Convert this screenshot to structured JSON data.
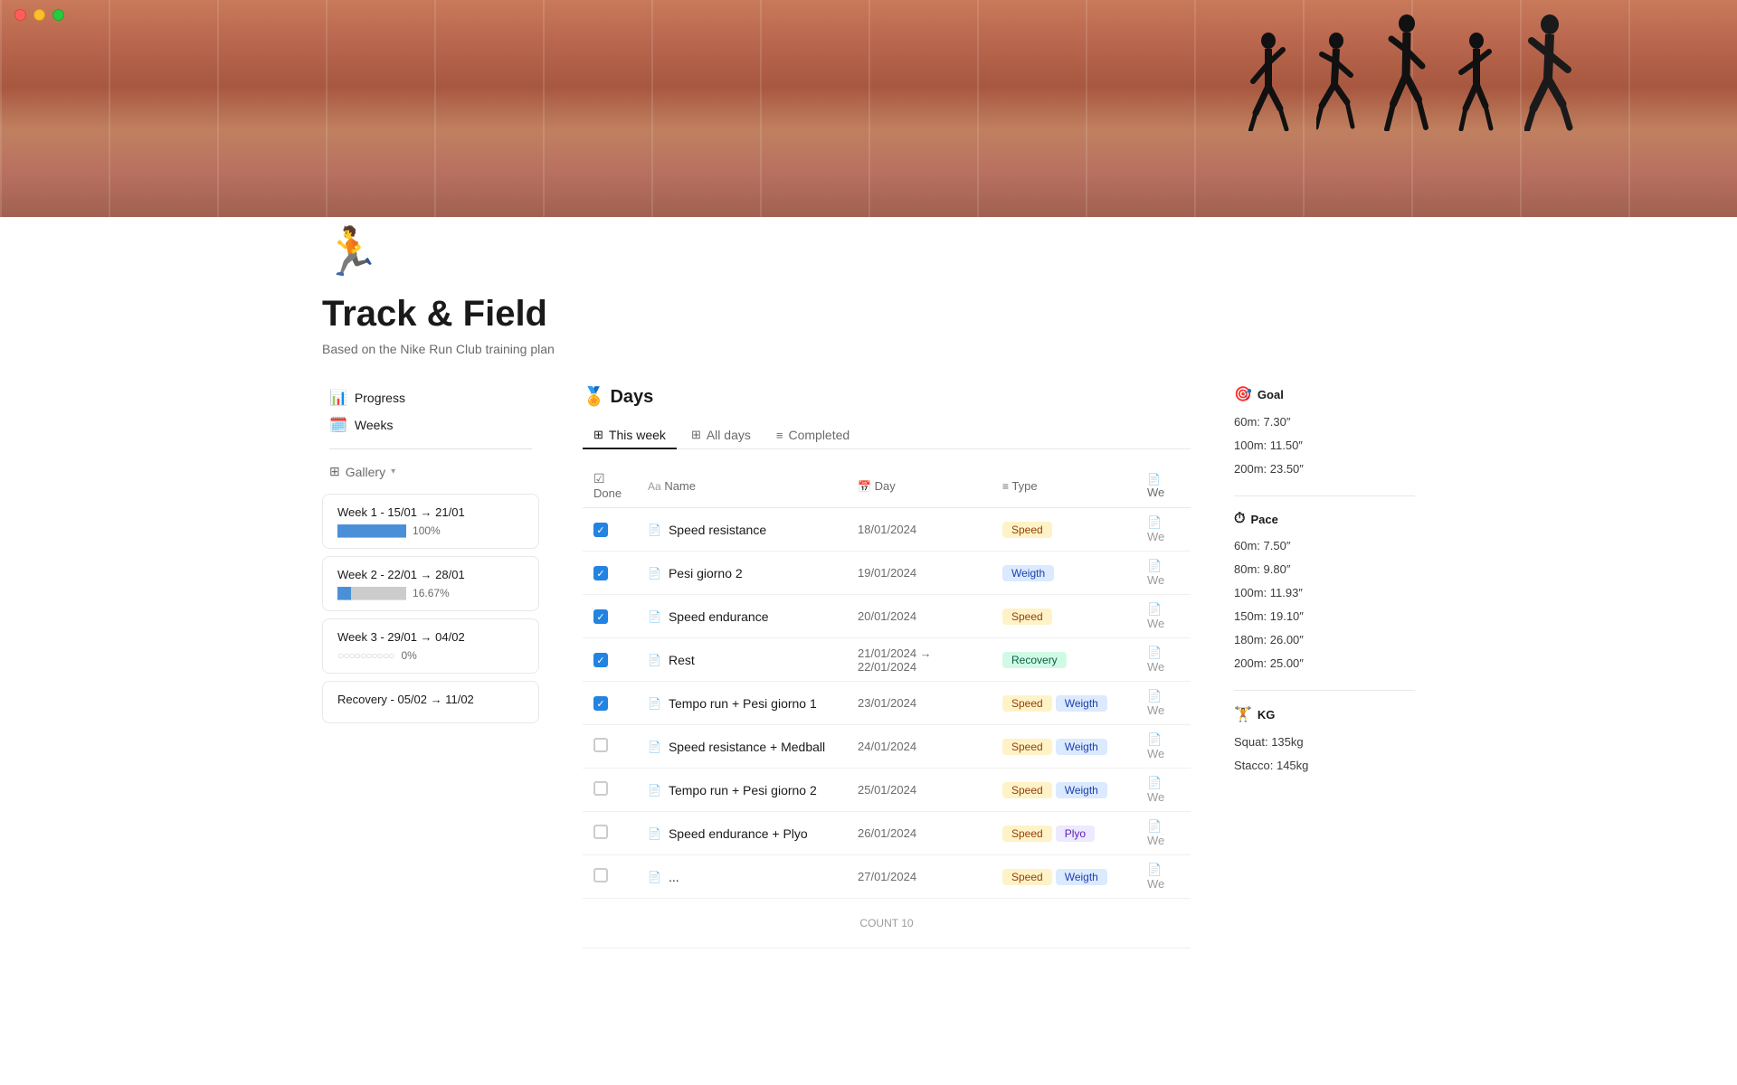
{
  "window": {
    "traffic_lights": [
      "red",
      "yellow",
      "green"
    ]
  },
  "page": {
    "icon": "🏃",
    "title": "Track & Field",
    "subtitle": "Based on the Nike Run Club training plan"
  },
  "sidebar": {
    "nav": [
      {
        "id": "progress",
        "icon": "📊",
        "label": "Progress"
      },
      {
        "id": "weeks",
        "icon": "🗓️",
        "label": "Weeks"
      }
    ],
    "gallery_label": "Gallery",
    "weeks": [
      {
        "title": "Week 1 - 15/01 → 21/01",
        "progress_filled": 10,
        "progress_empty": 0,
        "percent": "100%"
      },
      {
        "title": "Week 2 - 22/01 → 28/01",
        "progress_filled": 2,
        "progress_empty": 8,
        "percent": "16.67%"
      },
      {
        "title": "Week 3 - 29/01 → 04/02",
        "progress_filled": 0,
        "progress_empty": 10,
        "percent": "0%"
      },
      {
        "title": "Recovery - 05/02 → 11/02",
        "progress_filled": 0,
        "progress_empty": 0,
        "percent": ""
      }
    ]
  },
  "days_section": {
    "title": "🏅 Days",
    "tabs": [
      {
        "id": "this-week",
        "icon": "⊞",
        "label": "This week",
        "active": true
      },
      {
        "id": "all-days",
        "icon": "⊞",
        "label": "All days",
        "active": false
      },
      {
        "id": "completed",
        "icon": "≡",
        "label": "Completed",
        "active": false
      }
    ],
    "table": {
      "headers": [
        "Done",
        "Name",
        "Day",
        "Type",
        "We"
      ],
      "rows": [
        {
          "checked": true,
          "name": "Speed resistance",
          "day": "18/01/2024",
          "types": [
            {
              "label": "Speed",
              "class": "tag-speed"
            }
          ],
          "week": "We"
        },
        {
          "checked": true,
          "name": "Pesi giorno 2",
          "day": "19/01/2024",
          "types": [
            {
              "label": "Weigth",
              "class": "tag-weigth"
            }
          ],
          "week": "We"
        },
        {
          "checked": true,
          "name": "Speed endurance",
          "day": "20/01/2024",
          "types": [
            {
              "label": "Speed",
              "class": "tag-speed"
            }
          ],
          "week": "We"
        },
        {
          "checked": true,
          "name": "Rest",
          "day": "21/01/2024 → 22/01/2024",
          "types": [
            {
              "label": "Recovery",
              "class": "tag-recovery"
            }
          ],
          "week": "We"
        },
        {
          "checked": true,
          "name": "Tempo run + Pesi giorno 1",
          "day": "23/01/2024",
          "types": [
            {
              "label": "Speed",
              "class": "tag-speed"
            },
            {
              "label": "Weigth",
              "class": "tag-weigth"
            }
          ],
          "week": "We"
        },
        {
          "checked": false,
          "name": "Speed resistance + Medball",
          "day": "24/01/2024",
          "types": [
            {
              "label": "Speed",
              "class": "tag-speed"
            },
            {
              "label": "Weigth",
              "class": "tag-weigth"
            }
          ],
          "week": "We"
        },
        {
          "checked": false,
          "name": "Tempo run + Pesi giorno 2",
          "day": "25/01/2024",
          "types": [
            {
              "label": "Speed",
              "class": "tag-speed"
            },
            {
              "label": "Weigth",
              "class": "tag-weigth"
            }
          ],
          "week": "We"
        },
        {
          "checked": false,
          "name": "Speed endurance + Plyo",
          "day": "26/01/2024",
          "types": [
            {
              "label": "Speed",
              "class": "tag-speed"
            },
            {
              "label": "Plyo",
              "class": "tag-plyo"
            }
          ],
          "week": "We"
        },
        {
          "checked": false,
          "name": "...",
          "day": "27/01/2024",
          "types": [
            {
              "label": "Speed",
              "class": "tag-speed"
            },
            {
              "label": "Weigth",
              "class": "tag-weigth"
            }
          ],
          "week": "We"
        }
      ],
      "count_label": "COUNT",
      "count_value": "10"
    }
  },
  "right_sidebar": {
    "goal": {
      "title": "🎯 Goal",
      "items": [
        "60m: 7.30″",
        "100m: 11.50″",
        "200m: 23.50″"
      ]
    },
    "pace": {
      "title": "⏱ Pace",
      "items": [
        "60m: 7.50″",
        "80m: 9.80″",
        "100m: 11.93″",
        "150m: 19.10″",
        "180m: 26.00″",
        "200m: 25.00″"
      ]
    },
    "kg": {
      "title": "🏋️ KG",
      "items": [
        "Squat: 135kg",
        "Stacco: 145kg"
      ]
    }
  }
}
